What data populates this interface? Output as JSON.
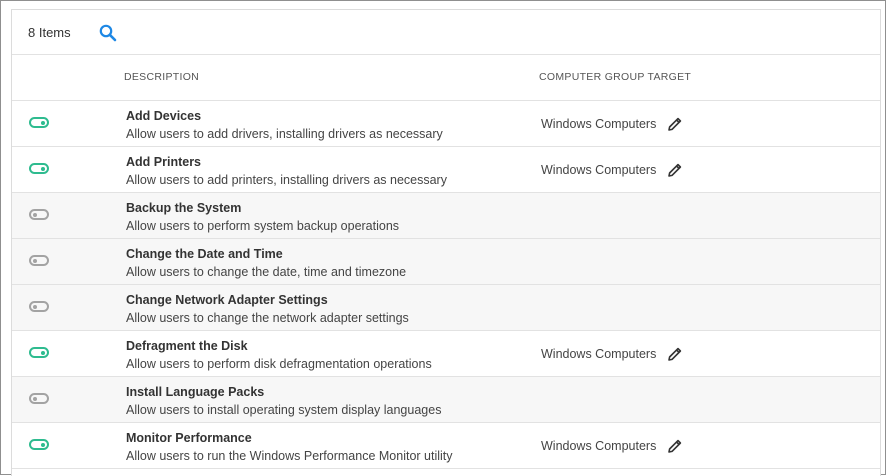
{
  "toolbar": {
    "item_count": "8 Items",
    "search_icon": "search-icon"
  },
  "columns": {
    "description": "DESCRIPTION",
    "target": "COMPUTER GROUP TARGET"
  },
  "colors": {
    "toggle_on": "#2ebb8f",
    "toggle_off": "#a3a3a3",
    "search_icon": "#1e88e5"
  },
  "rows": [
    {
      "enabled": true,
      "title": "Add Devices",
      "description": "Allow users to add drivers, installing drivers as necessary",
      "target": "Windows Computers"
    },
    {
      "enabled": true,
      "title": "Add Printers",
      "description": "Allow users to add printers, installing drivers as necessary",
      "target": "Windows Computers"
    },
    {
      "enabled": false,
      "title": "Backup the System",
      "description": "Allow users to perform system backup operations",
      "target": ""
    },
    {
      "enabled": false,
      "title": "Change the Date and Time",
      "description": "Allow users to change the date, time and timezone",
      "target": ""
    },
    {
      "enabled": false,
      "title": "Change Network Adapter Settings",
      "description": "Allow users to change the network adapter settings",
      "target": ""
    },
    {
      "enabled": true,
      "title": "Defragment the Disk",
      "description": "Allow users to perform disk defragmentation operations",
      "target": "Windows Computers"
    },
    {
      "enabled": false,
      "title": "Install Language Packs",
      "description": "Allow users to install operating system display languages",
      "target": ""
    },
    {
      "enabled": true,
      "title": "Monitor Performance",
      "description": "Allow users to run the Windows Performance Monitor utility",
      "target": "Windows Computers"
    }
  ]
}
